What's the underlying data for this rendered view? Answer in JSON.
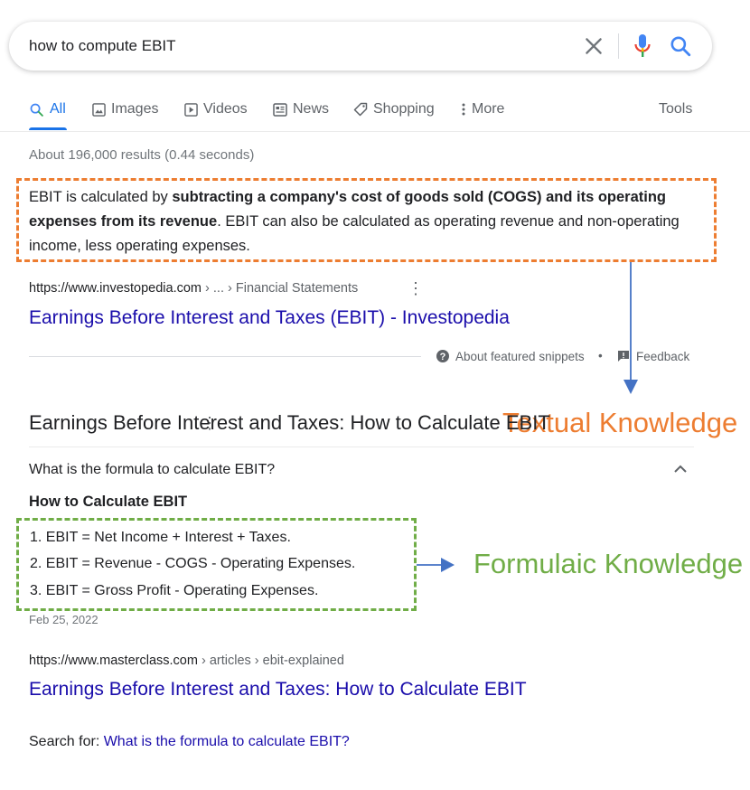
{
  "search": {
    "query": "how to compute EBIT"
  },
  "tabs": [
    {
      "label": "All",
      "icon": "search-icon",
      "active": true
    },
    {
      "label": "Images",
      "icon": "image-icon"
    },
    {
      "label": "Videos",
      "icon": "video-icon"
    },
    {
      "label": "News",
      "icon": "news-icon"
    },
    {
      "label": "Shopping",
      "icon": "tag-icon"
    },
    {
      "label": "More",
      "icon": "dots-vertical-icon"
    }
  ],
  "tools_label": "Tools",
  "result_stats": "About 196,000 results (0.44 seconds)",
  "featured_snippet": {
    "text_before": "EBIT is calculated by ",
    "text_bold": "subtracting a company's cost of goods sold (COGS) and its operating expenses from its revenue",
    "text_after": ". EBIT can also be calculated as operating revenue and non-operating income, less operating expenses.",
    "url_base": "https://www.investopedia.com",
    "url_path": " › ... › Financial Statements",
    "title": "Earnings Before Interest and Taxes (EBIT) - Investopedia",
    "about_label": "About featured snippets",
    "separator": "•",
    "feedback_label": "Feedback"
  },
  "paa": {
    "title": "Earnings Before Interest and Taxes: How to Calculate EBIT",
    "question": "What is the formula to calculate EBIT?",
    "answer_heading": "How to Calculate EBIT",
    "formulas": [
      "1. EBIT = Net Income + Interest + Taxes.",
      "2. EBIT = Revenue - COGS - Operating Expenses.",
      "3. EBIT = Gross Profit - Operating Expenses."
    ],
    "date": "Feb 25, 2022",
    "url_base": "https://www.masterclass.com",
    "url_path": " › articles › ebit-explained"
  },
  "search_for": {
    "label": "Search for: ",
    "link": "What is the formula to calculate EBIT?"
  },
  "annotations": {
    "textual": "Textual Knowledge",
    "formulaic": "Formulaic Knowledge"
  },
  "colors": {
    "accent_blue": "#1a73e8",
    "link": "#1a0dab",
    "annotation_orange": "#ed7d31",
    "annotation_green": "#70ad47",
    "arrow_blue": "#4472c4"
  }
}
